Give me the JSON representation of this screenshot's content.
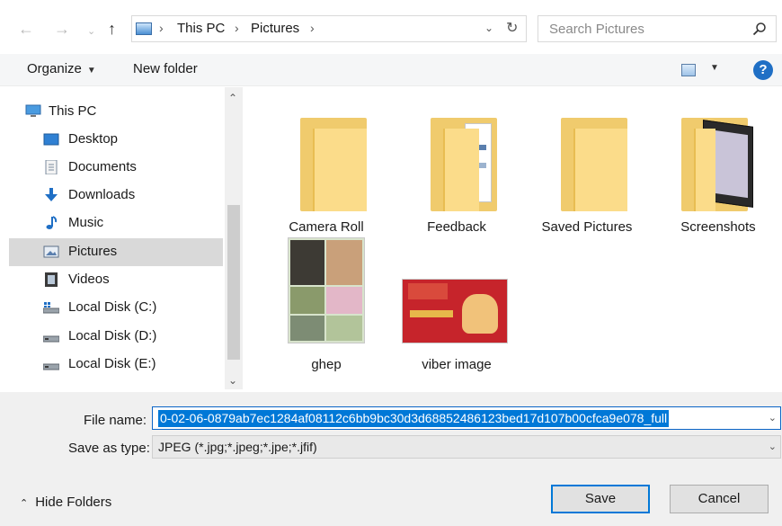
{
  "address_bar": {
    "segments": [
      "This PC",
      "Pictures"
    ],
    "search_placeholder": "Search Pictures"
  },
  "toolbar": {
    "organize_label": "Organize",
    "new_folder_label": "New folder",
    "help_label": "?"
  },
  "sidebar": {
    "items": [
      {
        "label": "This PC",
        "icon": "pc-icon"
      },
      {
        "label": "Desktop",
        "icon": "desktop-icon"
      },
      {
        "label": "Documents",
        "icon": "documents-icon"
      },
      {
        "label": "Downloads",
        "icon": "downloads-icon"
      },
      {
        "label": "Music",
        "icon": "music-icon"
      },
      {
        "label": "Pictures",
        "icon": "pictures-icon",
        "selected": true
      },
      {
        "label": "Videos",
        "icon": "videos-icon"
      },
      {
        "label": "Local Disk (C:)",
        "icon": "drive-c-icon"
      },
      {
        "label": "Local Disk (D:)",
        "icon": "drive-icon"
      },
      {
        "label": "Local Disk (E:)",
        "icon": "drive-icon"
      }
    ]
  },
  "files": {
    "items": [
      {
        "label": "Camera Roll",
        "type": "folder"
      },
      {
        "label": "Feedback",
        "type": "folder"
      },
      {
        "label": "Saved Pictures",
        "type": "folder"
      },
      {
        "label": "Screenshots",
        "type": "folder"
      },
      {
        "label": "ghep",
        "type": "image"
      },
      {
        "label": "viber image",
        "type": "image"
      }
    ]
  },
  "footer": {
    "file_name_label": "File name:",
    "file_name_value": "0-02-06-0879ab7ec1284af08112c6bb9bc30d3d68852486123bed17d107b00cfca9e078_full",
    "save_type_label": "Save as type:",
    "save_type_value": "JPEG (*.jpg;*.jpeg;*.jpe;*.jfif)",
    "hide_folders_label": "Hide Folders",
    "save_label": "Save",
    "cancel_label": "Cancel"
  },
  "colors": {
    "accent": "#0078d7",
    "folder": "#fbdc8a",
    "selection_bg": "#d9d9d9"
  }
}
